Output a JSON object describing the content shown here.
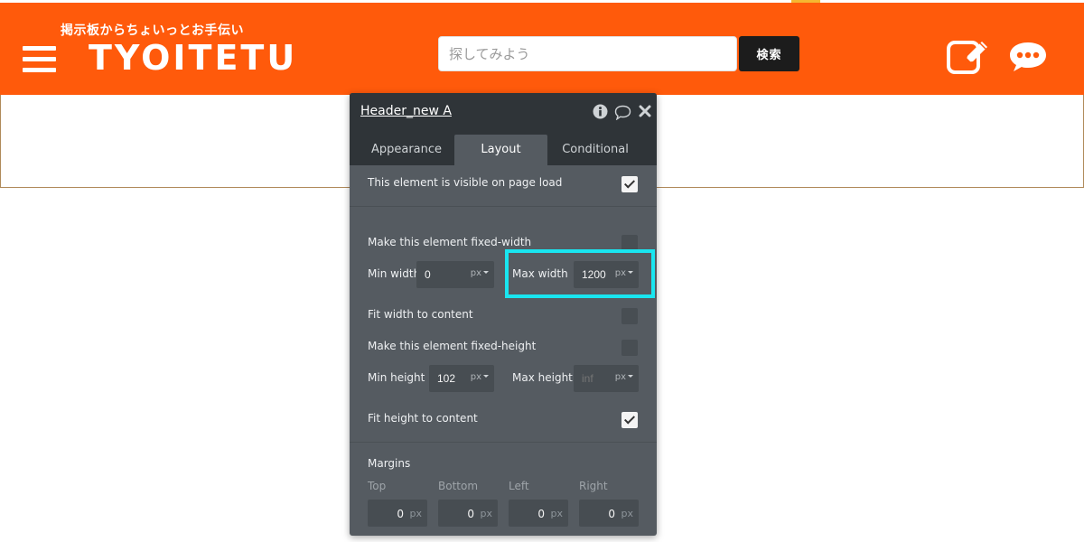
{
  "header": {
    "tagline": "掲示板からちょいっとお手伝い",
    "logo": "TYOITETU",
    "search_placeholder": "探してみよう",
    "search_button": "検索",
    "menu_icon": "hamburger-icon",
    "post_icon": "edit-icon",
    "chat_icon": "chat-icon",
    "brand_color": "#ff5a0b"
  },
  "panel": {
    "title": "Header_new A",
    "icons": [
      "info-icon",
      "comment-icon",
      "close-icon"
    ],
    "tabs": [
      {
        "label": "Appearance",
        "active": false
      },
      {
        "label": "Layout",
        "active": true
      },
      {
        "label": "Conditional",
        "active": false
      }
    ],
    "visible_on_load": {
      "label": "This element is visible on page load",
      "checked": true
    },
    "fixed_width": {
      "label": "Make this element fixed-width",
      "checked": false
    },
    "min_width": {
      "label": "Min width",
      "value": "0",
      "unit": "px"
    },
    "max_width": {
      "label": "Max width",
      "value": "1200",
      "unit": "px"
    },
    "fit_width": {
      "label": "Fit width to content",
      "checked": false
    },
    "fixed_height": {
      "label": "Make this element fixed-height",
      "checked": false
    },
    "min_height": {
      "label": "Min height",
      "value": "102",
      "unit": "px"
    },
    "max_height": {
      "label": "Max height",
      "placeholder": "inf",
      "unit": "px"
    },
    "fit_height": {
      "label": "Fit height to content",
      "checked": true
    },
    "margins": {
      "title": "Margins",
      "top": {
        "label": "Top",
        "value": "0",
        "unit": "px"
      },
      "bottom": {
        "label": "Bottom",
        "value": "0",
        "unit": "px"
      },
      "left": {
        "label": "Left",
        "value": "0",
        "unit": "px"
      },
      "right": {
        "label": "Right",
        "value": "0",
        "unit": "px"
      }
    }
  },
  "highlight_color": "#19e6f0"
}
